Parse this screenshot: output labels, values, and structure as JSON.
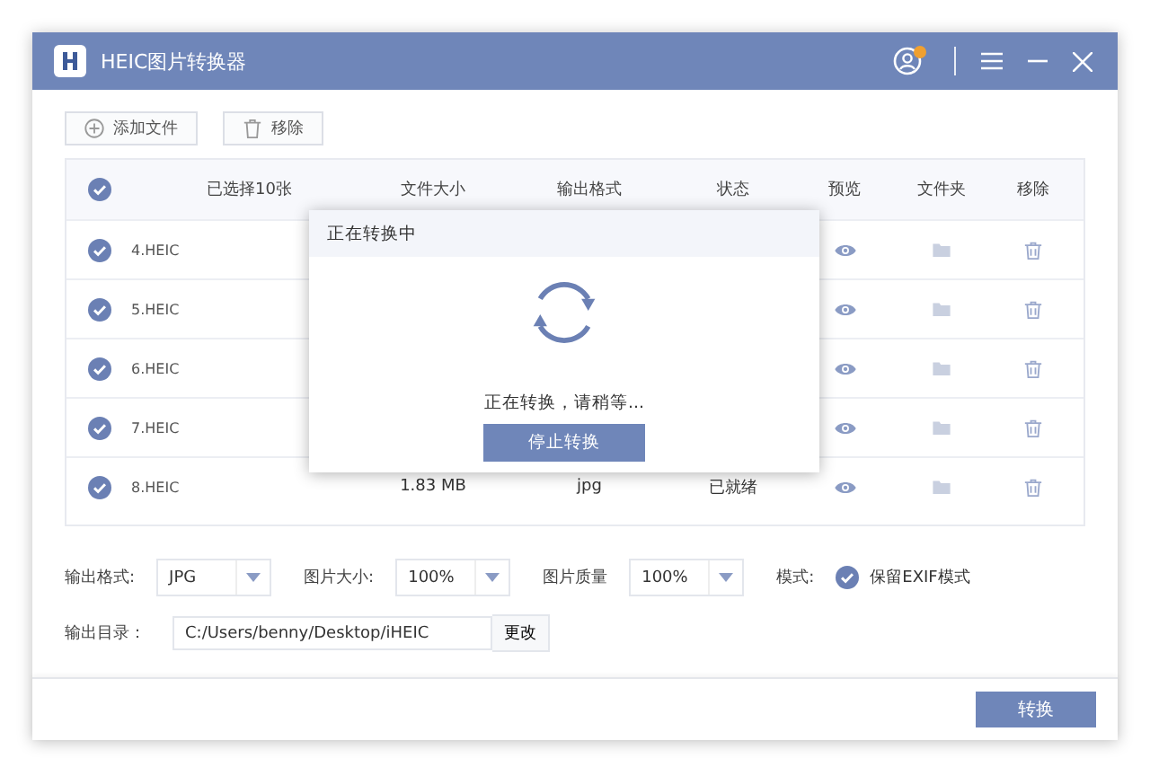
{
  "window": {
    "title": "HEIC图片转换器"
  },
  "toolbar": [
    {
      "kind": "add",
      "label": "添加文件"
    },
    {
      "kind": "remove",
      "label": "移除"
    }
  ],
  "table": {
    "select_all": {
      "checked": true
    },
    "columns": [
      "已选择10张",
      "文件大小",
      "输出格式",
      "状态",
      "预览",
      "文件夹",
      "移除"
    ],
    "rows": [
      {
        "name": "4.HEIC",
        "checked": true
      },
      {
        "name": "5.HEIC",
        "checked": true
      },
      {
        "name": "6.HEIC",
        "checked": true
      },
      {
        "name": "7.HEIC",
        "checked": true
      },
      {
        "name": "8.HEIC",
        "checked": true,
        "size": "1.83 MB",
        "format": "jpg",
        "status": "已就绪"
      }
    ]
  },
  "dialog": {
    "title": "正在转换中",
    "message": "正在转换，请稍等...",
    "button": "停止转换"
  },
  "settings": {
    "format": {
      "label": "输出格式:",
      "value": "JPG"
    },
    "size": {
      "label": "图片大小:",
      "value": "100%"
    },
    "quality": {
      "label": "图片质量",
      "value": "100%"
    },
    "mode": {
      "label": "模式:",
      "option": "保留EXIF模式",
      "checked": true
    },
    "output_dir": {
      "label": "输出目录：",
      "value": "C:/Users/benny/Desktop/iHEIC",
      "button": "更改"
    }
  },
  "convert_button": "转换"
}
